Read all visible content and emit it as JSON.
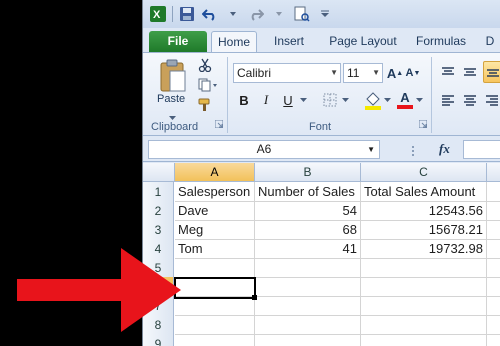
{
  "app": {
    "name": "Microsoft Excel",
    "accent": "#1f7a2a"
  },
  "tabs": [
    "File",
    "Home",
    "Insert",
    "Page Layout",
    "Formulas",
    "D"
  ],
  "ribbon": {
    "clipboard": {
      "paste": "Paste",
      "label": "Clipboard"
    },
    "font": {
      "name": "Calibri",
      "size": "11",
      "label": "Font",
      "bold": "B",
      "italic": "I",
      "underline": "U",
      "grow": "A",
      "shrink": "A",
      "font_color": "A"
    }
  },
  "formula_bar": {
    "name_box": "A6",
    "fx": "fx",
    "value": ""
  },
  "columns": [
    "A",
    "B",
    "C"
  ],
  "rows": [
    "1",
    "2",
    "3",
    "4",
    "5",
    "6",
    "7",
    "8",
    "9"
  ],
  "cells": [
    [
      "Salesperson",
      "Number of Sales",
      "Total Sales Amount"
    ],
    [
      "Dave",
      "54",
      "12543.56"
    ],
    [
      "Meg",
      "68",
      "15678.21"
    ],
    [
      "Tom",
      "41",
      "19732.98"
    ],
    [
      "",
      "",
      ""
    ],
    [
      "",
      "",
      ""
    ],
    [
      "",
      "",
      ""
    ],
    [
      "",
      "",
      ""
    ],
    [
      "",
      "",
      ""
    ]
  ],
  "selected_cell": "A6",
  "annotation": {
    "arrow_color": "#e8141b"
  }
}
